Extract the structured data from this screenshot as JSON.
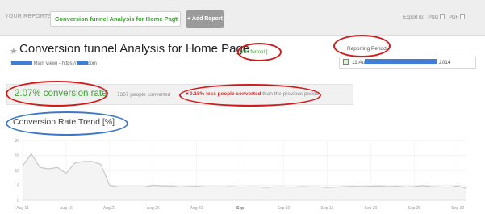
{
  "topbar": {
    "your_reports_label": "YOUR REPORTS",
    "selected_report": "Conversion funnel Analysis for Home Page",
    "add_report_label": "+ Add Report",
    "export_label": "Export to:",
    "export_formats": [
      "PNG",
      "PDF"
    ]
  },
  "header": {
    "title": "Conversion funnel Analysis for Home Page",
    "edit_link": "edit funnel",
    "subtitle_prefix": "(",
    "subtitle_view": "Main View) - https://",
    "subtitle_suffix": "com"
  },
  "period": {
    "label": "Reporting Period",
    "date_start": "11 Au",
    "date_end": "2014"
  },
  "summary": {
    "conversion_rate": "2.07% conversion rate",
    "people_converted": "7307 people converted",
    "change_arrow": "▼",
    "change_value": "0.18% less people converted",
    "change_suffix": " than the previous period"
  },
  "trend": {
    "title": "Conversion Rate Trend [%]"
  },
  "colors": {
    "accent_green": "#3aa52e",
    "negative_red": "#d03030",
    "annotation_red": "#d11c1c",
    "annotation_blue": "#3b79c7",
    "redaction_blue": "#3f7fd6",
    "line_color": "#c8c8c8"
  },
  "chart_data": {
    "type": "area",
    "title": "Conversion Rate Trend [%]",
    "xlabel": "",
    "ylabel": "",
    "ylim": [
      0,
      20
    ],
    "yticks": [
      "20",
      "15",
      "10",
      "5",
      "0"
    ],
    "xtick_labels": [
      "Aug 11",
      "Aug 16",
      "Aug 21",
      "Aug 26",
      "Aug 31",
      "Sep",
      "Sep 10",
      "Sep 15",
      "Sep 20",
      "Sep 25",
      "Sep 30"
    ],
    "bold_ticks": [
      "Sep"
    ],
    "x": [
      "Aug 11",
      "Aug 12",
      "Aug 13",
      "Aug 14",
      "Aug 15",
      "Aug 16",
      "Aug 17",
      "Aug 18",
      "Aug 19",
      "Aug 20",
      "Aug 21",
      "Aug 22",
      "Aug 23",
      "Aug 24",
      "Aug 25",
      "Aug 26",
      "Aug 27",
      "Aug 28",
      "Aug 29",
      "Aug 30",
      "Aug 31",
      "Sep 1",
      "Sep 2",
      "Sep 3",
      "Sep 4",
      "Sep 5",
      "Sep 6",
      "Sep 7",
      "Sep 8",
      "Sep 9",
      "Sep 10",
      "Sep 11",
      "Sep 12",
      "Sep 13",
      "Sep 14",
      "Sep 15",
      "Sep 16",
      "Sep 17",
      "Sep 18",
      "Sep 19",
      "Sep 20",
      "Sep 21",
      "Sep 22",
      "Sep 23",
      "Sep 24",
      "Sep 25",
      "Sep 26",
      "Sep 27",
      "Sep 28",
      "Sep 29",
      "Sep 30",
      "Oct 1"
    ],
    "series": [
      {
        "values": [
          11.5,
          15.5,
          11,
          10.5,
          11,
          9,
          12.5,
          13,
          13,
          12,
          5,
          4.5,
          4.5,
          4.5,
          4.5,
          5,
          4.8,
          4.8,
          4.5,
          4.6,
          4.7,
          4.5,
          4.5,
          4.5,
          4.6,
          4.4,
          4.5,
          4.5,
          4.3,
          4.5,
          4.5,
          4.4,
          4.6,
          4.5,
          4.5,
          4.3,
          4.4,
          4.6,
          4.7,
          4.6,
          4.7,
          4.8,
          4.6,
          4.7,
          4.5,
          4.6,
          4.9,
          4.6,
          4.5,
          4.4,
          4.8,
          4
        ]
      }
    ],
    "grid": true,
    "legend": "none"
  }
}
